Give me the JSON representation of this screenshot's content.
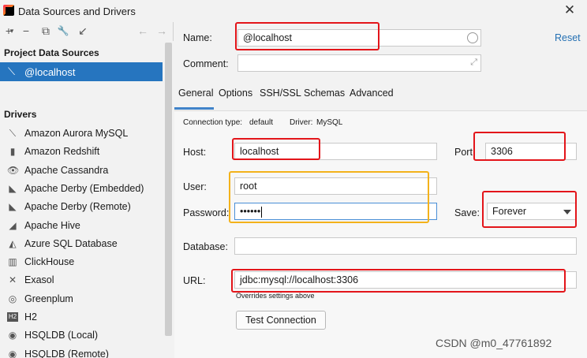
{
  "window": {
    "title": "Data Sources and Drivers"
  },
  "toolbar": {
    "add": "+",
    "add_dropdown": "▾",
    "remove": "−",
    "duplicate": "⧉",
    "settings": "🔧",
    "import": "↙",
    "back": "←",
    "forward": "→"
  },
  "left": {
    "project_sources_title": "Project Data Sources",
    "selected_source": "@localhost",
    "drivers_title": "Drivers",
    "drivers": [
      {
        "label": "Amazon Aurora MySQL",
        "icon": "⟍"
      },
      {
        "label": "Amazon Redshift",
        "icon": "▮"
      },
      {
        "label": "Apache Cassandra",
        "icon": "👁"
      },
      {
        "label": "Apache Derby (Embedded)",
        "icon": "◣"
      },
      {
        "label": "Apache Derby (Remote)",
        "icon": "◣"
      },
      {
        "label": "Apache Hive",
        "icon": "◢"
      },
      {
        "label": "Azure SQL Database",
        "icon": "◭"
      },
      {
        "label": "ClickHouse",
        "icon": "▥"
      },
      {
        "label": "Exasol",
        "icon": "✕"
      },
      {
        "label": "Greenplum",
        "icon": "◎"
      },
      {
        "label": "H2",
        "icon": "H2"
      },
      {
        "label": "HSQLDB (Local)",
        "icon": "◉"
      },
      {
        "label": "HSQLDB (Remote)",
        "icon": "◉"
      }
    ]
  },
  "right": {
    "name_label": "Name:",
    "name_value": "@localhost",
    "comment_label": "Comment:",
    "comment_value": "",
    "reset": "Reset",
    "tabs": [
      "General",
      "Options",
      "SSH/SSL",
      "Schemas",
      "Advanced"
    ],
    "connection_type_label": "Connection type:",
    "connection_type_value": "default",
    "driver_label": "Driver:",
    "driver_value": "MySQL",
    "host_label": "Host:",
    "host_value": "localhost",
    "port_label": "Port:",
    "port_value": "3306",
    "user_label": "User:",
    "user_value": "root",
    "password_label": "Password:",
    "password_value": "••••••",
    "save_label": "Save:",
    "save_value": "Forever",
    "database_label": "Database:",
    "database_value": "",
    "url_label": "URL:",
    "url_value": "jdbc:mysql://localhost:3306",
    "url_hint": "Overrides settings above",
    "test_button": "Test Connection"
  },
  "watermark": "CSDN @m0_47761892",
  "colors": {
    "selection": "#2675bf",
    "annotation_red": "#e3151a",
    "annotation_orange": "#f3b21b",
    "link": "#2470b3"
  }
}
